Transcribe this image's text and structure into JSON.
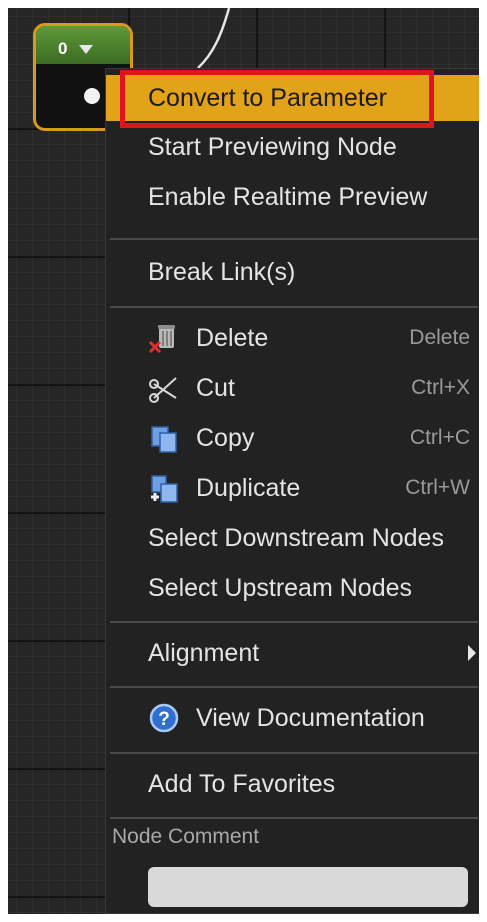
{
  "node": {
    "value": "0"
  },
  "menu": {
    "items": [
      {
        "label": "Convert to Parameter",
        "highlighted": true
      },
      {
        "label": "Start Previewing Node"
      },
      {
        "label": "Enable Realtime Preview"
      },
      {
        "label": "Break Link(s)"
      },
      {
        "label": "Delete",
        "shortcut": "Delete",
        "icon": "trash-icon"
      },
      {
        "label": "Cut",
        "shortcut": "Ctrl+X",
        "icon": "scissors-icon"
      },
      {
        "label": "Copy",
        "shortcut": "Ctrl+C",
        "icon": "copy-icon"
      },
      {
        "label": "Duplicate",
        "shortcut": "Ctrl+W",
        "icon": "duplicate-icon"
      },
      {
        "label": "Select Downstream Nodes"
      },
      {
        "label": "Select Upstream Nodes"
      },
      {
        "label": "Alignment",
        "has_submenu": true
      },
      {
        "label": "View Documentation",
        "icon": "help-icon"
      },
      {
        "label": "Add To Favorites"
      }
    ],
    "comment": {
      "label": "Node Comment",
      "value": ""
    }
  },
  "colors": {
    "highlight": "#e3a319",
    "annotation": "#e0141c",
    "node_header": "#4f8a2e",
    "node_border": "#d89a1e"
  }
}
